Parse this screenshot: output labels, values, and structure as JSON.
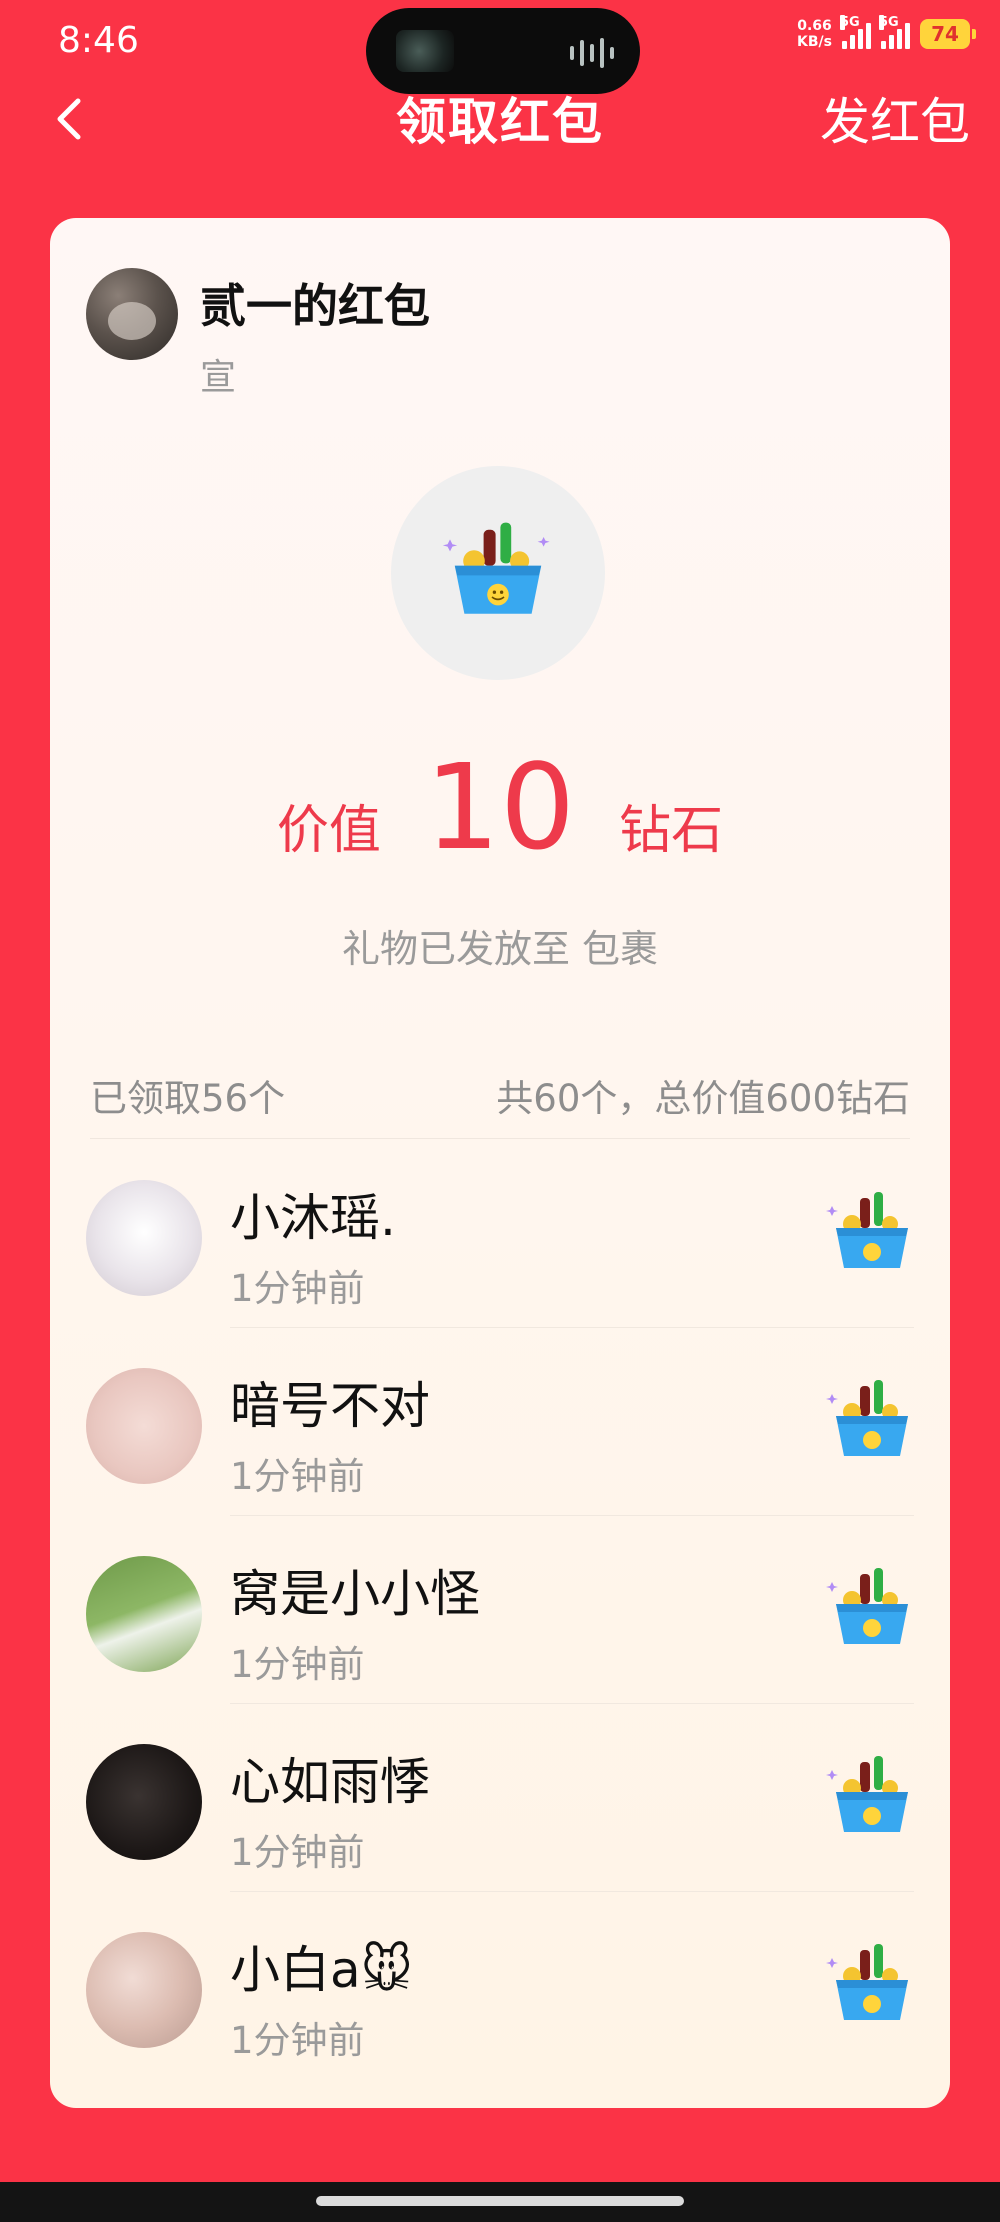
{
  "status_bar": {
    "time": "8:46",
    "net_speed_value": "0.66",
    "net_speed_unit": "KB/s",
    "signal1_label": "5G",
    "signal2_label": "5G",
    "battery": "74"
  },
  "nav": {
    "title": "领取红包",
    "action_label": "发红包"
  },
  "packet": {
    "title": "贰一的红包",
    "subtitle": "宣",
    "value_prefix": "价值",
    "value_amount": "10",
    "value_unit": "钻石",
    "delivery_note": "礼物已发放至 包裹"
  },
  "summary": {
    "claimed": "已领取56个",
    "total": "共60个，总价值600钻石"
  },
  "recipients": [
    {
      "name": "小沐瑶.",
      "time": "1分钟前"
    },
    {
      "name": "暗号不对",
      "time": "1分钟前"
    },
    {
      "name": "窝是小小怪",
      "time": "1分钟前"
    },
    {
      "name": "心如雨悸",
      "time": "1分钟前"
    },
    {
      "name": "小白a🐭",
      "time": "1分钟前"
    }
  ],
  "icons": {
    "back": "chevron-left-icon",
    "gift": "drink-basket-gift-icon"
  },
  "colors": {
    "background": "#fb3346",
    "accent_value": "#ee3a4b",
    "card_top": "#fff7f5",
    "card_bottom": "#fff4e6"
  }
}
